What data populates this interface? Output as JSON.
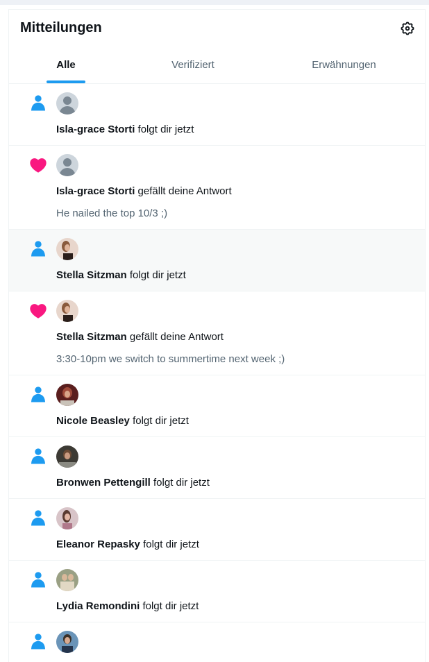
{
  "header": {
    "title": "Mitteilungen",
    "settings_icon": "gear-icon"
  },
  "tabs": [
    {
      "label": "Alle",
      "active": true
    },
    {
      "label": "Verifiziert",
      "active": false
    },
    {
      "label": "Erwähnungen",
      "active": false
    }
  ],
  "colors": {
    "accent": "#1d9bf0",
    "like": "#f91880",
    "text": "#0f1419",
    "muted": "#536471"
  },
  "notifications": [
    {
      "type": "follow",
      "icon": "person-icon",
      "name": "Isla-grace Storti",
      "action": "folgt dir jetzt"
    },
    {
      "type": "like",
      "icon": "heart-icon",
      "name": "Isla-grace Storti",
      "action": "gefällt deine Antwort",
      "text": "He nailed the top 10/3 ;)"
    },
    {
      "type": "follow",
      "icon": "person-icon",
      "name": "Stella Sitzman",
      "action": "folgt dir jetzt"
    },
    {
      "type": "like",
      "icon": "heart-icon",
      "name": "Stella Sitzman",
      "action": "gefällt deine Antwort",
      "text": "3:30-10pm we switch to summertime next week ;)"
    },
    {
      "type": "follow",
      "icon": "person-icon",
      "name": "Nicole Beasley",
      "action": "folgt dir jetzt"
    },
    {
      "type": "follow",
      "icon": "person-icon",
      "name": "Bronwen Pettengill",
      "action": "folgt dir jetzt"
    },
    {
      "type": "follow",
      "icon": "person-icon",
      "name": "Eleanor Repasky",
      "action": "folgt dir jetzt"
    },
    {
      "type": "follow",
      "icon": "person-icon",
      "name": "Lydia Remondini",
      "action": "folgt dir jetzt"
    },
    {
      "type": "follow",
      "icon": "person-icon"
    }
  ]
}
